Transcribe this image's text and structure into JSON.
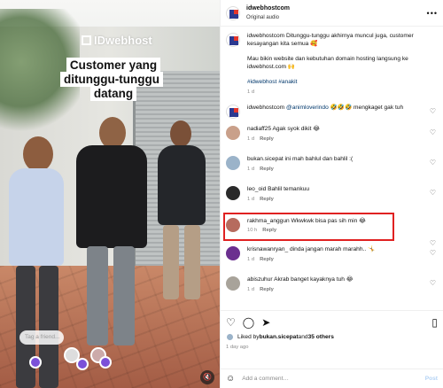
{
  "media": {
    "watermark": "IDwebhost",
    "caption_line1": "Customer yang",
    "caption_line2": "ditunggu-tunggu datang",
    "tag_placeholder": "Tag a friend..."
  },
  "header": {
    "username": "idwebhostcom",
    "subtitle": "Original audio",
    "more": "•••"
  },
  "post": {
    "username": "idwebhostcom",
    "text1": "Ditunggu-tunggu akhirnya muncul juga, customer kesayangan kita semua 🥰",
    "text2": "Mau bikin website dan kebutuhan domain hosting langsung ke idwebhost.com 🙌",
    "hashtags": "#idwebhost #anakit",
    "time": "1 d"
  },
  "comments": [
    {
      "user": "idwebhostcom",
      "mention": "@animloverindo",
      "text": " 🤣🤣🤣 mengkaget gak tuh",
      "time": "",
      "reply": "",
      "avatar": "logo"
    },
    {
      "user": "nadiaff25",
      "text": "Agak syok dikit 😂",
      "time": "1 d",
      "reply": "Reply",
      "avatar": "#c9a08a"
    },
    {
      "user": "bukan.sicepat",
      "text": "ini mah bahlul dan bahlil :(",
      "time": "1 d",
      "reply": "Reply",
      "avatar": "#9bb3c9"
    },
    {
      "user": "leo_oid",
      "text": "Bahlil temankuu",
      "time": "1 d",
      "reply": "Reply",
      "avatar": "#2a2a2a"
    },
    {
      "user": "rakhma_anggun",
      "text": "Wkwkwk bisa pas sih min 😂",
      "time": "10 h",
      "reply": "Reply",
      "avatar": "#b66b5e"
    },
    {
      "user": "krisnawanryan_",
      "text": "dinda jangan marah marahh.. 🤸",
      "time": "1 d",
      "reply": "Reply",
      "avatar": "#6b2f8f"
    },
    {
      "user": "abiszuhur",
      "text": "Akrab banget kayaknya tuh 😂",
      "time": "1 d",
      "reply": "Reply",
      "avatar": "#a8a39a"
    }
  ],
  "likes": {
    "prefix": "Liked by ",
    "user": "bukan.sicepat",
    "middle": " and ",
    "others": "35 others",
    "ago": "1 day ago"
  },
  "add_comment": {
    "placeholder": "Add a comment…",
    "post": "Post"
  },
  "icons": {
    "like": "heart-icon",
    "comment": "comment-icon",
    "share": "share-icon",
    "save": "bookmark-icon",
    "mute": "speaker-muted-icon"
  },
  "colors": {
    "highlight": "#e02121",
    "link": "#00376b",
    "post_disabled": "#b4d3f5"
  }
}
